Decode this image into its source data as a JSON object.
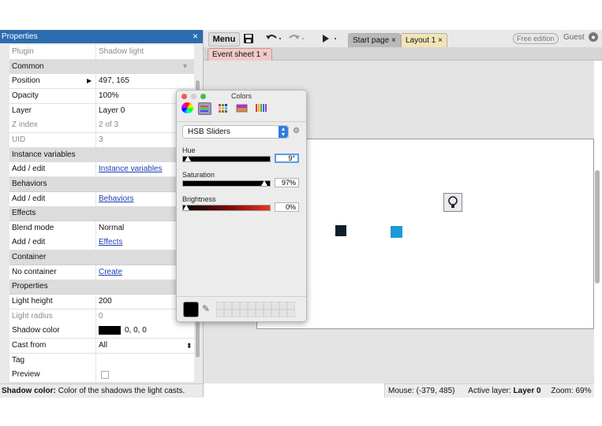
{
  "properties": {
    "title": "Properties",
    "close": "×",
    "rows": [
      {
        "name": "Plugin",
        "value": "Shadow light",
        "kind": "prop",
        "dim": true
      },
      {
        "name": "Common",
        "value": "",
        "kind": "cat"
      },
      {
        "name": "Position",
        "value": "497, 165",
        "kind": "prop"
      },
      {
        "name": "Opacity",
        "value": "100%",
        "kind": "prop"
      },
      {
        "name": "Layer",
        "value": "Layer 0",
        "kind": "prop"
      },
      {
        "name": "Z index",
        "value": "2 of 3",
        "kind": "prop",
        "dim": true
      },
      {
        "name": "UID",
        "value": "3",
        "kind": "prop",
        "dim": true
      },
      {
        "name": "Instance variables",
        "value": "",
        "kind": "cat"
      },
      {
        "name": "Add / edit",
        "value": "Instance variables",
        "kind": "link"
      },
      {
        "name": "Behaviors",
        "value": "",
        "kind": "cat"
      },
      {
        "name": "Add / edit",
        "value": "Behaviors",
        "kind": "link"
      },
      {
        "name": "Effects",
        "value": "",
        "kind": "cat"
      },
      {
        "name": "Blend mode",
        "value": "Normal",
        "kind": "prop"
      },
      {
        "name": "Add / edit",
        "value": "Effects",
        "kind": "link"
      },
      {
        "name": "Container",
        "value": "",
        "kind": "cat"
      },
      {
        "name": "No container",
        "value": "Create",
        "kind": "link"
      },
      {
        "name": "Properties",
        "value": "",
        "kind": "cat"
      },
      {
        "name": "Light height",
        "value": "200",
        "kind": "prop"
      },
      {
        "name": "Light radius",
        "value": "0",
        "kind": "prop",
        "dim": true
      },
      {
        "name": "Shadow color",
        "value": "0, 0, 0",
        "kind": "color"
      },
      {
        "name": "Cast from",
        "value": "All",
        "kind": "select"
      },
      {
        "name": "Tag",
        "value": "",
        "kind": "prop"
      },
      {
        "name": "Preview",
        "value": "",
        "kind": "check"
      }
    ],
    "help_label": "Shadow color:",
    "help_text": "Color of the shadows the light casts."
  },
  "toolbar": {
    "menu": "Menu",
    "tab_start": "Start page",
    "tab_layout": "Layout 1",
    "tab_close": "×",
    "free_edition": "Free edition",
    "guest": "Guest"
  },
  "subtabs": {
    "event_sheet": "Event sheet 1",
    "close": "×"
  },
  "statusbar": {
    "mouse": "Mouse: (-379, 485)",
    "active_layer_label": "Active layer:",
    "active_layer": "Layer 0",
    "zoom": "Zoom: 69%"
  },
  "colors_dialog": {
    "title": "Colors",
    "mode": "HSB Sliders",
    "hue_label": "Hue",
    "hue_value": "9°",
    "hue_level": 0.02,
    "saturation_label": "Saturation",
    "saturation_value": "97%",
    "saturation_level": 0.97,
    "brightness_label": "Brightness",
    "brightness_value": "0%",
    "brightness_level": 0.0
  }
}
